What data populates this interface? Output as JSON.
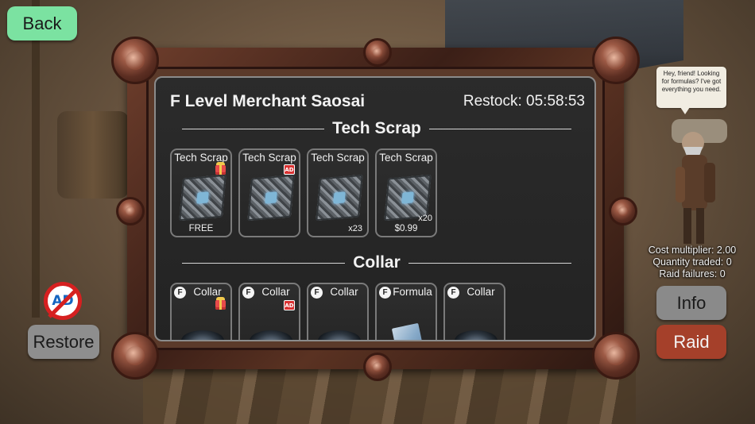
{
  "buttons": {
    "back": "Back",
    "restore": "Restore",
    "info": "Info",
    "raid": "Raid"
  },
  "no_ads_badge": "AD",
  "merchant": {
    "name": "F Level Merchant Saosai",
    "restock_label": "Restock: 05:58:53",
    "speech": "Hey, friend! Looking for formulas? I've got everything you need."
  },
  "stats": {
    "cost_multiplier": "Cost multiplier: 2.00",
    "quantity_traded": "Quantity traded: 0",
    "raid_failures": "Raid failures: 0"
  },
  "sections": [
    {
      "title": "Tech Scrap",
      "items": [
        {
          "name": "Tech Scrap",
          "icon": "gift-icon",
          "price": "FREE",
          "qty": ""
        },
        {
          "name": "Tech Scrap",
          "icon": "ad-icon",
          "price": "",
          "qty": ""
        },
        {
          "name": "Tech Scrap",
          "icon": "",
          "price": "",
          "qty": "x23"
        },
        {
          "name": "Tech Scrap",
          "icon": "",
          "price": "$0.99",
          "qty": "x20"
        }
      ]
    },
    {
      "title": "Collar",
      "items": [
        {
          "badge": "F",
          "name": "Collar",
          "icon": "gift-icon"
        },
        {
          "badge": "F",
          "name": "Collar",
          "icon": "ad-icon"
        },
        {
          "badge": "F",
          "name": "Collar",
          "icon": ""
        },
        {
          "badge": "F",
          "name": "Formula",
          "icon": ""
        },
        {
          "badge": "F",
          "name": "Collar",
          "icon": ""
        }
      ]
    }
  ],
  "ad_icon_text": "AD",
  "colors": {
    "back_button": "#7be2a1",
    "raid_button": "#a5402a",
    "info_button": "#8a8a8a",
    "restore_button": "#8e8e8e",
    "panel_bg": "#262626"
  }
}
